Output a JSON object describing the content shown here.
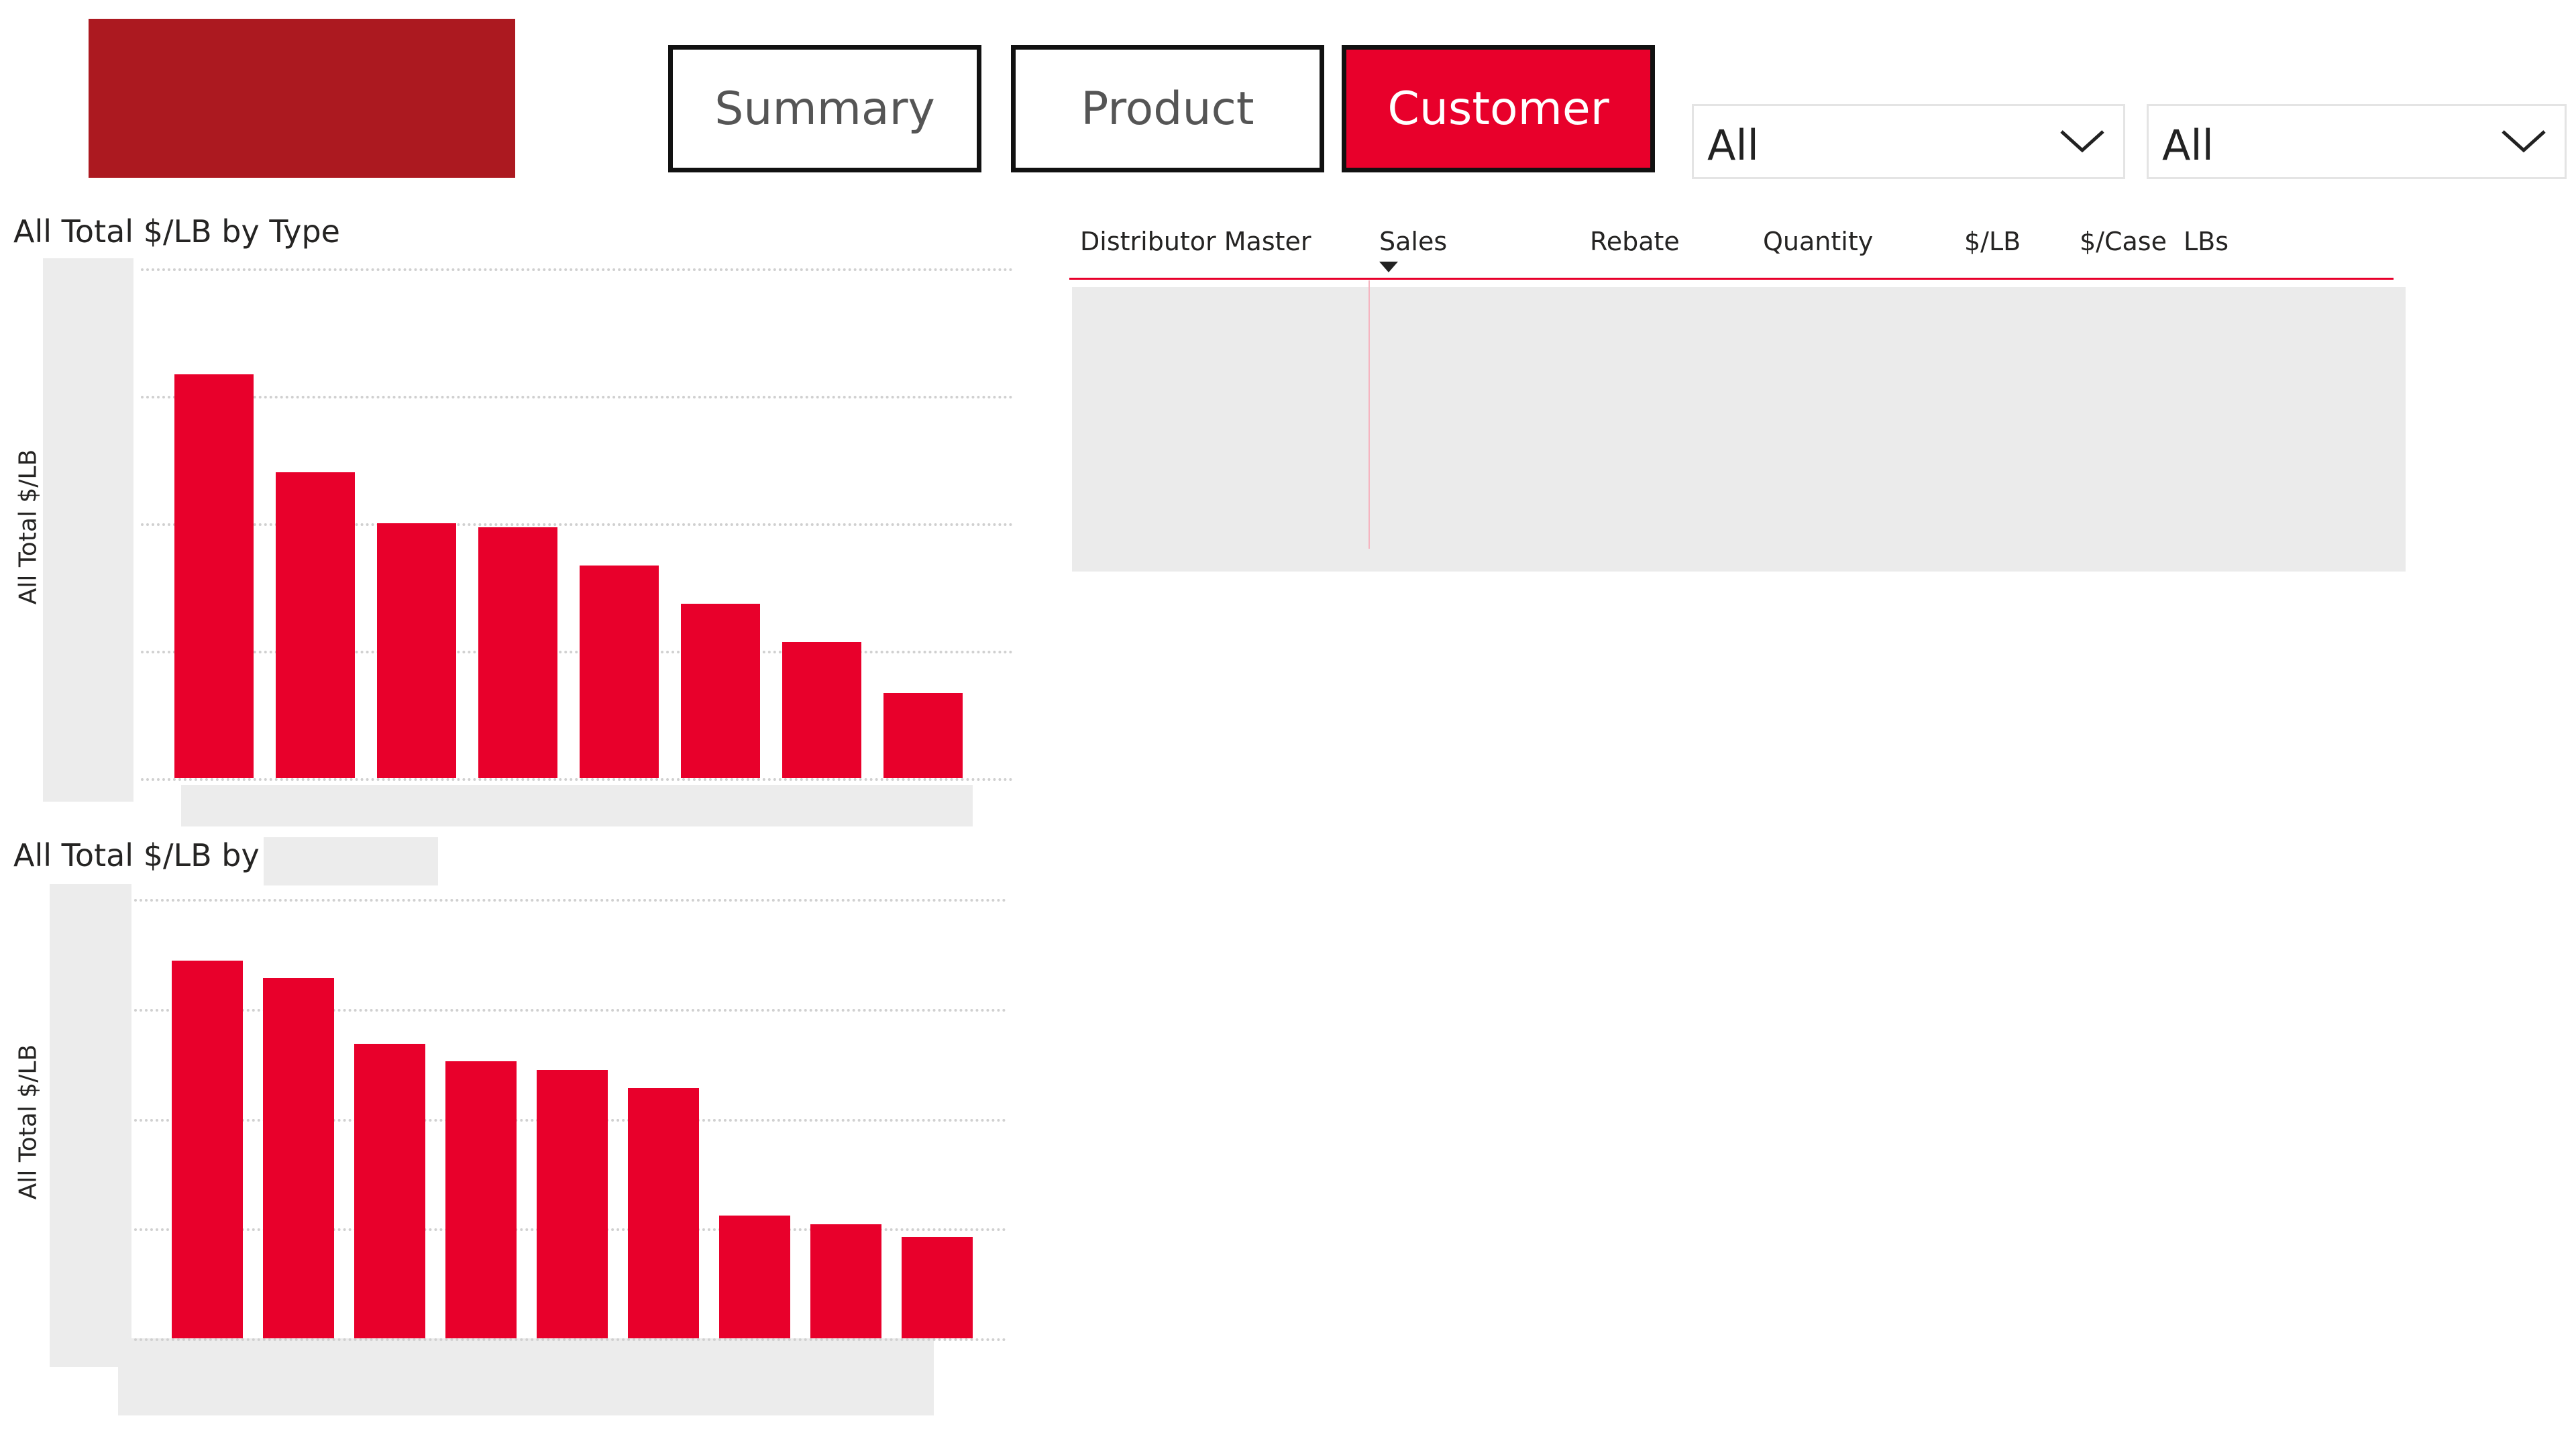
{
  "nav": {
    "summary_label": "Summary",
    "product_label": "Product",
    "customer_label": "Customer",
    "active": "Customer"
  },
  "filters": {
    "filter1_value": "All",
    "filter2_value": "All"
  },
  "chart1": {
    "title": "All Total $/LB by Type",
    "ylabel": "All Total $/LB"
  },
  "chart2": {
    "title": "All Total $/LB by",
    "ylabel": "All Total $/LB"
  },
  "chart_data": [
    {
      "type": "bar",
      "title": "All Total $/LB by Type",
      "ylabel": "All Total $/LB",
      "xlabel": "",
      "categories": [],
      "values": [
        0.95,
        0.72,
        0.6,
        0.59,
        0.5,
        0.41,
        0.32,
        0.2
      ],
      "ylim": [
        0,
        1.2
      ],
      "grid": true,
      "color": "#e8002b"
    },
    {
      "type": "bar",
      "title": "All Total $/LB by",
      "ylabel": "All Total $/LB",
      "xlabel": "",
      "categories": [],
      "values": [
        0.86,
        0.82,
        0.67,
        0.63,
        0.61,
        0.57,
        0.28,
        0.26,
        0.23
      ],
      "ylim": [
        0,
        1.0
      ],
      "grid": true,
      "color": "#e8002b"
    }
  ],
  "table": {
    "columns": [
      "Distributor Master",
      "Sales",
      "Rebate",
      "Quantity",
      "$/LB",
      "$/Case",
      "LBs"
    ],
    "sorted_column": "Sales"
  },
  "colors": {
    "accent": "#e8002b",
    "logo": "#ac1920"
  },
  "icons": {
    "dropdown": "chevron-down-icon",
    "sort": "sort-desc-icon"
  }
}
